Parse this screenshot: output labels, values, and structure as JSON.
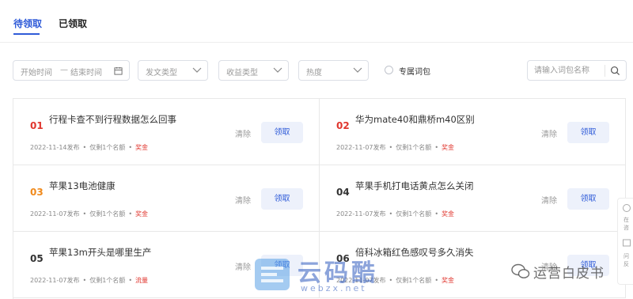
{
  "tabs": [
    {
      "label": "待领取",
      "active": true
    },
    {
      "label": "已领取",
      "active": false
    }
  ],
  "filters": {
    "date_start_placeholder": "开始时间",
    "date_separator": "—",
    "date_end_placeholder": "结束时间",
    "post_type": "发文类型",
    "revenue_type": "收益类型",
    "heat": "热度",
    "exclusive_label": "专属词包",
    "search_placeholder": "请输入词包名称"
  },
  "items": [
    {
      "num": "01",
      "title": "行程卡查不到行程数据怎么回事",
      "date": "2022-11-14发布",
      "remaining": "仅剩1个名额",
      "tag": "奖金",
      "clear": "清除",
      "claim": "领取"
    },
    {
      "num": "02",
      "title": "华为mate40和鼎桥m40区别",
      "date": "2022-11-07发布",
      "remaining": "仅剩1个名额",
      "tag": "奖金",
      "clear": "清除",
      "claim": "领取"
    },
    {
      "num": "03",
      "title": "苹果13电池健康",
      "date": "2022-11-07发布",
      "remaining": "仅剩1个名额",
      "tag": "奖金",
      "clear": "清除",
      "claim": "领取"
    },
    {
      "num": "04",
      "title": "苹果手机打电话黄点怎么关闭",
      "date": "2022-11-07发布",
      "remaining": "仅剩1个名额",
      "tag": "奖金",
      "clear": "清除",
      "claim": "领取"
    },
    {
      "num": "05",
      "title": "苹果13m开头是哪里生产",
      "date": "2022-11-07发布",
      "remaining": "仅剩1个名额",
      "tag": "流量",
      "clear": "清除",
      "claim": "领取"
    },
    {
      "num": "06",
      "title": "倍科冰箱红色感叹号多久消失",
      "date": "2022-11-07发布",
      "remaining": "仅剩1个名额",
      "tag": "奖金",
      "clear": "清除",
      "claim": "领取"
    }
  ],
  "side_panel": [
    "在",
    "咨",
    "问",
    "反"
  ],
  "watermarks": {
    "site_name": "云码酷",
    "site_url": "webzx.net",
    "account": "运营白皮书"
  },
  "colors": {
    "accent": "#2f5bd8",
    "rank_top": "#e0362e",
    "rank_third": "#f08a1c",
    "tag": "#e0362e",
    "claim_bg": "#edf1fb"
  }
}
